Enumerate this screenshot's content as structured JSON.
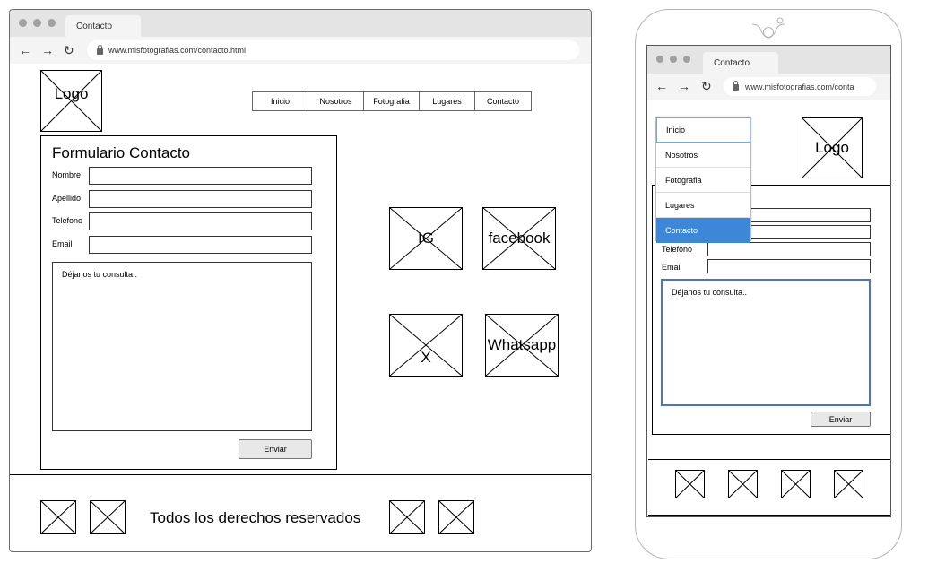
{
  "desktop": {
    "tab_title": "Contacto",
    "url": "www.misfotografias.com/contacto.html",
    "logo_label": "Logo",
    "nav": [
      "Inicio",
      "Nosotros",
      "Fotografia",
      "Lugares",
      "Contacto"
    ],
    "form": {
      "title": "Formulario Contacto",
      "fields": [
        "Nombre",
        "Apellido",
        "Telefono",
        "Email"
      ],
      "message_placeholder": "Déjanos tu consulta..",
      "submit_label": "Enviar"
    },
    "social": [
      "IG",
      "facebook",
      "X",
      "Whatsapp"
    ],
    "footer_text": "Todos los derechos reservados"
  },
  "mobile": {
    "tab_title": "Contacto",
    "url": "www.misfotografias.com/conta",
    "logo_label": "Logo",
    "menu": [
      "Inicio",
      "Nosotros",
      "Fotografia",
      "Lugares",
      "Contacto"
    ],
    "menu_active": "Contacto",
    "fields": [
      "Telefono",
      "Email"
    ],
    "message_placeholder": "Déjanos tu consulta..",
    "submit_label": "Enviar"
  },
  "colors": {
    "active_menu_bg": "#3d87d8",
    "focus_border": "#4a74c9",
    "chrome_bg": "#e4e4e4"
  },
  "icons": {
    "back": "arrow-left-icon",
    "forward": "arrow-right-icon",
    "reload": "reload-icon",
    "lock": "lock-icon",
    "placeholder": "image-placeholder-icon"
  }
}
